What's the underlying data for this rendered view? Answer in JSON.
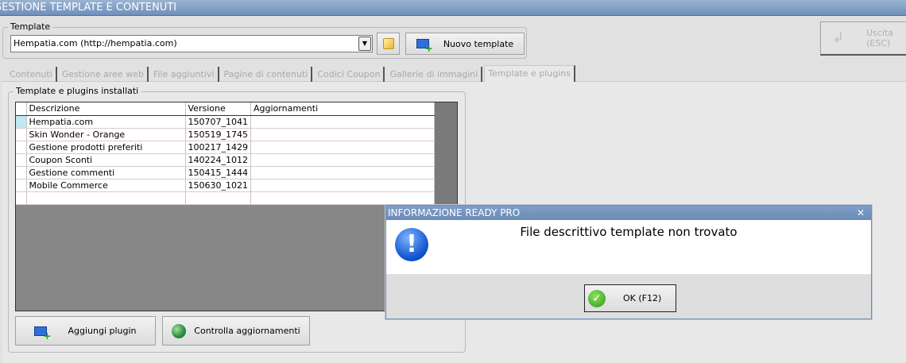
{
  "window": {
    "title": "GESTIONE TEMPLATE E CONTENUTI"
  },
  "template_group": {
    "label": "Template",
    "selected": "Hempatia.com (http://hempatia.com)",
    "new_button": "Nuovo template"
  },
  "exit_button": "Uscita (ESC)",
  "tabs": [
    {
      "label": "Contenuti"
    },
    {
      "label": "Gestione aree web"
    },
    {
      "label": "File aggiuntivi"
    },
    {
      "label": "Pagine di contenuti"
    },
    {
      "label": "Codici Coupon"
    },
    {
      "label": "Gallerie di immagini"
    },
    {
      "label": "Template e plugins",
      "active": true
    }
  ],
  "plugins": {
    "label": "Template e plugins installati",
    "columns": [
      "Descrizione",
      "Versione",
      "Aggiornamenti"
    ],
    "rows": [
      [
        "Hempatia.com",
        "150707_1041",
        ""
      ],
      [
        "Skin Wonder - Orange",
        "150519_1745",
        ""
      ],
      [
        "Gestione prodotti preferiti",
        "100217_1429",
        ""
      ],
      [
        "Coupon Sconti",
        "140224_1012",
        ""
      ],
      [
        "Gestione commenti",
        "150415_1444",
        ""
      ],
      [
        "Mobile Commerce",
        "150630_1021",
        ""
      ]
    ],
    "add_button": "Aggiungi plugin",
    "check_button": "Controlla aggiornamenti"
  },
  "dialog": {
    "title": "INFORMAZIONE READY PRO",
    "message": "File descrittivo template non trovato",
    "ok_button": "OK (F12)",
    "icon": "info-exclamation-icon"
  }
}
